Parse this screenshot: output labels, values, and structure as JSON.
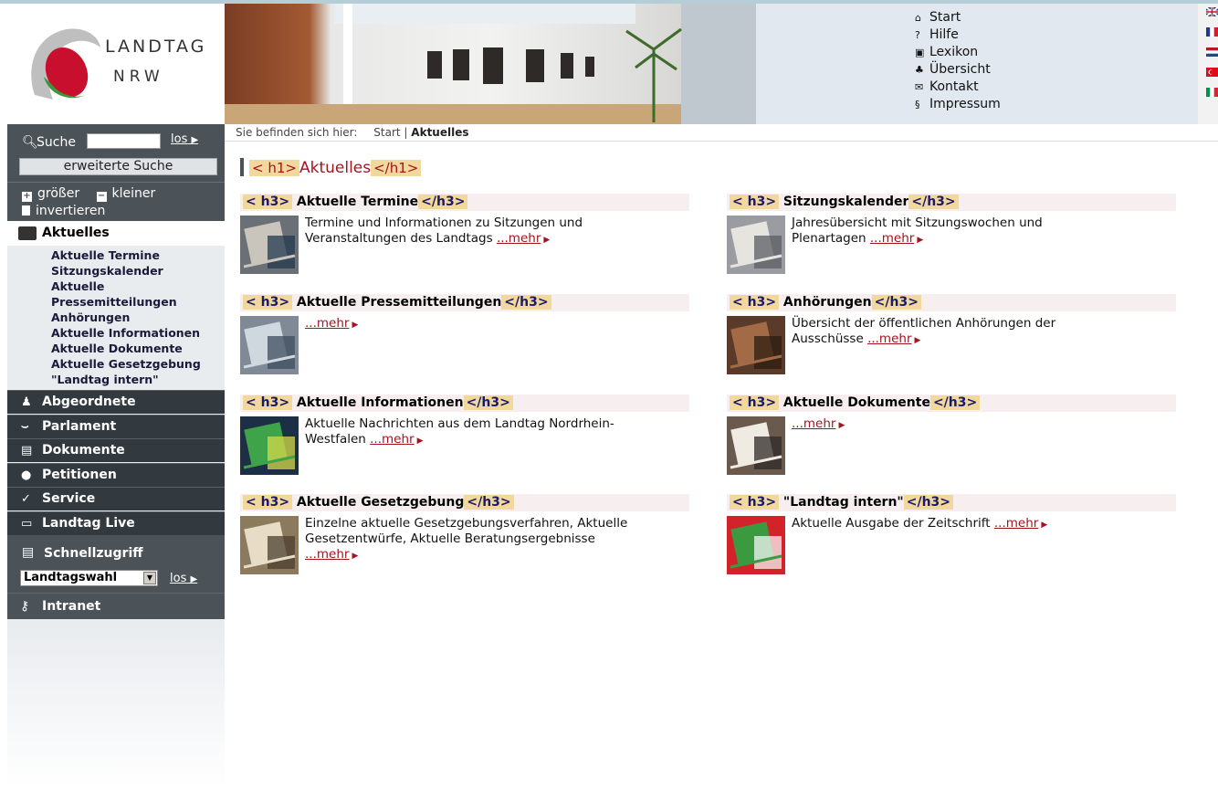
{
  "site": {
    "logo_line1": "LANDTAG",
    "logo_line2": "NRW"
  },
  "service_nav": [
    {
      "icon": "home-icon",
      "glyph": "⌂",
      "label": "Start"
    },
    {
      "icon": "help-icon",
      "glyph": "?",
      "label": "Hilfe"
    },
    {
      "icon": "lexicon-icon",
      "glyph": "▣",
      "label": "Lexikon"
    },
    {
      "icon": "sitemap-icon",
      "glyph": "♣",
      "label": "Übersicht"
    },
    {
      "icon": "mail-icon",
      "glyph": "✉",
      "label": "Kontakt"
    },
    {
      "icon": "paragraph-icon",
      "glyph": "§",
      "label": "Impressum"
    }
  ],
  "search": {
    "label": "Suche",
    "go": "los",
    "advanced": "erweiterte Suche"
  },
  "font_controls": {
    "bigger": "größer",
    "smaller": "kleiner",
    "invert": "invertieren"
  },
  "nav": {
    "active": "Aktuelles",
    "sub": [
      "Aktuelle Termine",
      "Sitzungskalender",
      "Aktuelle Pressemitteilungen",
      "Anhörungen",
      "Aktuelle Informationen",
      "Aktuelle Dokumente",
      "Aktuelle Gesetzgebung",
      "\"Landtag intern\""
    ],
    "sections": [
      {
        "name": "abgeordnete",
        "label": "Abgeordnete",
        "glyph": "♟"
      },
      {
        "name": "parlament",
        "label": "Parlament",
        "glyph": "⌣"
      },
      {
        "name": "dokumente",
        "label": "Dokumente",
        "glyph": "▤"
      },
      {
        "name": "petitionen",
        "label": "Petitionen",
        "glyph": "●"
      },
      {
        "name": "service",
        "label": "Service",
        "glyph": "✓"
      },
      {
        "name": "landtag-live",
        "label": "Landtag Live",
        "glyph": "▭"
      }
    ],
    "schnellzugriff": "Schnellzugriff",
    "schnell_selected": "Landtagswahl",
    "schnell_go": "los",
    "intranet": "Intranet"
  },
  "breadcrumb": {
    "prefix": "Sie befinden sich hier:",
    "home": "Start",
    "sep": "|",
    "current": "Aktuelles"
  },
  "content": {
    "h1_open": "< h1>",
    "h1_text": "Aktuelles",
    "h1_close": "</h1>",
    "h3_open": "< h3>",
    "h3_close": "</h3>",
    "more": "...mehr",
    "items": [
      {
        "title": "Aktuelle Termine",
        "text": "Termine und Informationen zu Sitzungen und Veranstaltungen des Landtags"
      },
      {
        "title": "Sitzungskalender",
        "text": "Jahresübersicht mit Sitzungswochen und Plenartagen"
      },
      {
        "title": "Aktuelle Pressemitteilungen",
        "text": ""
      },
      {
        "title": "Anhörungen",
        "text": "Übersicht der öffentlichen Anhörungen der Ausschüsse"
      },
      {
        "title": "Aktuelle Informationen",
        "text": "Aktuelle Nachrichten aus dem Landtag Nordrhein-Westfalen"
      },
      {
        "title": "Aktuelle Dokumente",
        "text": ""
      },
      {
        "title": "Aktuelle Gesetzgebung",
        "text": "Einzelne aktuelle Gesetzgebungsverfahren, Aktuelle Gesetzentwürfe, Aktuelle Beratungsergebnisse"
      },
      {
        "title": "\"Landtag intern\"",
        "text": "Aktuelle Ausgabe der Zeitschrift"
      }
    ]
  },
  "colors": {
    "accent": "#a3141e",
    "sidebar_dark": "#4b5258",
    "tag_bg": "#f2d89c"
  }
}
